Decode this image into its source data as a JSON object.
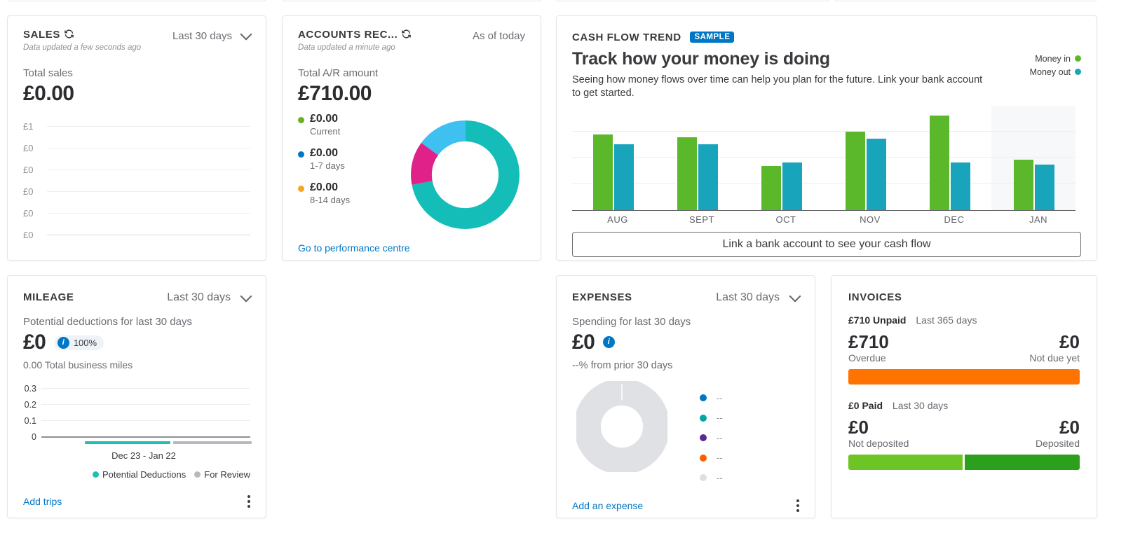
{
  "sales": {
    "title": "SALES",
    "refresh_icon": "refresh-icon",
    "period": "Last 30 days",
    "chevron_icon": "chevron-down-icon",
    "updated_note": "Data updated a few seconds ago",
    "metric_label": "Total sales",
    "metric_value": "£0.00",
    "axis_ticks": [
      "£1",
      "£0",
      "£0",
      "£0",
      "£0",
      "£0"
    ]
  },
  "accounts_receivable": {
    "title": "ACCOUNTS REC...",
    "refresh_icon": "refresh-icon",
    "period": "As of today",
    "updated_note": "Data updated a minute ago",
    "metric_label": "Total A/R amount",
    "metric_value": "£710.00",
    "legend": [
      {
        "amount": "£0.00",
        "label": "Current",
        "color": "#6ab023"
      },
      {
        "amount": "£0.00",
        "label": "1-7 days",
        "color": "#0077c5"
      },
      {
        "amount": "£0.00",
        "label": "8-14 days",
        "color": "#f5a623"
      }
    ],
    "link": "Go to performance centre",
    "donut": {
      "segments": [
        {
          "name": "teal",
          "color": "#15bdb9",
          "percent": 72
        },
        {
          "name": "magenta",
          "color": "#e0218a",
          "percent": 13
        },
        {
          "name": "light-blue",
          "color": "#3ec1f0",
          "percent": 15
        }
      ]
    }
  },
  "cash_flow": {
    "title": "CASH FLOW TREND",
    "badge": "SAMPLE",
    "heading": "Track how your money is doing",
    "description": "Seeing how money flows over time can help you plan for the future. Link your bank account to get started.",
    "legend": [
      {
        "label": "Money in",
        "color": "#5cb82b"
      },
      {
        "label": "Money out",
        "color": "#18a4bb"
      }
    ],
    "button": "Link a bank account to see your cash flow",
    "highlight_category": "JAN"
  },
  "mileage": {
    "title": "MILEAGE",
    "period": "Last 30 days",
    "chevron_icon": "chevron-down-icon",
    "subtitle": "Potential deductions for last 30 days",
    "amount": "£0",
    "info_icon": "info-icon",
    "badge_percent": "100%",
    "total_miles": "0.00 Total business miles",
    "axis_ticks": [
      "0.3",
      "0.2",
      "0.1",
      "0"
    ],
    "x_label": "Dec 23 - Jan 22",
    "legend": [
      {
        "label": "Potential Deductions",
        "color": "#1fbfb8"
      },
      {
        "label": "For Review",
        "color": "#b7b9bd"
      }
    ],
    "link": "Add trips",
    "kebab_icon": "kebab-menu-icon"
  },
  "expenses": {
    "title": "EXPENSES",
    "period": "Last 30 days",
    "chevron_icon": "chevron-down-icon",
    "subtitle": "Spending for last 30 days",
    "amount": "£0",
    "info_icon": "info-icon",
    "comparison": "--% from prior 30 days",
    "legend": [
      {
        "label": "--",
        "color": "#0077c5"
      },
      {
        "label": "--",
        "color": "#00a6a3"
      },
      {
        "label": "--",
        "color": "#5a2a8c"
      },
      {
        "label": "--",
        "color": "#ff5c00"
      },
      {
        "label": "--",
        "color": "#dcdfe3"
      }
    ],
    "donut_color": "#dfe1e5",
    "link": "Add an expense",
    "kebab_icon": "kebab-menu-icon"
  },
  "invoices": {
    "title": "INVOICES",
    "unpaid_amount": "£710 Unpaid",
    "unpaid_period": "Last 365 days",
    "overdue_value": "£710",
    "overdue_label": "Overdue",
    "notdue_value": "£0",
    "notdue_label": "Not due yet",
    "unpaid_bar": [
      {
        "name": "overdue",
        "color": "#ff7300",
        "percent": 100
      }
    ],
    "paid_amount": "£0 Paid",
    "paid_period": "Last 30 days",
    "notdeposited_value": "£0",
    "notdeposited_label": "Not deposited",
    "deposited_value": "£0",
    "deposited_label": "Deposited",
    "paid_bar": [
      {
        "name": "not-deposited",
        "color": "#6dc425",
        "percent": 49.5
      },
      {
        "name": "deposited",
        "color": "#2ca01c",
        "percent": 49.5
      }
    ]
  },
  "chart_data": [
    {
      "type": "bar",
      "name": "cash-flow-trend",
      "title": "Track how your money is doing",
      "categories": [
        "AUG",
        "SEPT",
        "OCT",
        "NOV",
        "DEC",
        "JAN"
      ],
      "series": [
        {
          "name": "Money in",
          "color": "#5cb82b",
          "values": [
            72,
            69,
            42,
            75,
            90,
            48
          ]
        },
        {
          "name": "Money out",
          "color": "#18a4bb",
          "values": [
            63,
            63,
            45,
            68,
            45,
            44
          ]
        }
      ],
      "xlabel": "",
      "ylabel": "",
      "ylim": [
        0,
        100
      ],
      "grid": true,
      "legend_position": "top-right"
    },
    {
      "type": "line",
      "name": "sales-trend",
      "title": "Total sales",
      "ytick_labels": [
        "£1",
        "£0",
        "£0",
        "£0",
        "£0",
        "£0"
      ],
      "values": [
        0,
        0,
        0,
        0,
        0,
        0
      ],
      "ylim": [
        0,
        1
      ],
      "grid": true
    },
    {
      "type": "bar",
      "name": "mileage-trend",
      "title": "Potential deductions for last 30 days",
      "categories": [
        "Dec 23 - Jan 22"
      ],
      "ytick_labels": [
        "0.3",
        "0.2",
        "0.1",
        "0"
      ],
      "series": [
        {
          "name": "Potential Deductions",
          "color": "#1fbfb8",
          "values": [
            0
          ]
        },
        {
          "name": "For Review",
          "color": "#b7b9bd",
          "values": [
            0
          ]
        }
      ],
      "ylim": [
        0,
        0.3
      ],
      "grid": true,
      "legend_position": "bottom-right"
    },
    {
      "type": "pie",
      "name": "accounts-receivable-donut",
      "labels": [
        "teal",
        "magenta",
        "light-blue"
      ],
      "values": [
        72,
        13,
        15
      ],
      "colors": [
        "#15bdb9",
        "#e0218a",
        "#3ec1f0"
      ]
    },
    {
      "type": "pie",
      "name": "expenses-donut",
      "labels": [
        "--"
      ],
      "values": [
        100
      ],
      "colors": [
        "#dfe1e5"
      ]
    }
  ]
}
